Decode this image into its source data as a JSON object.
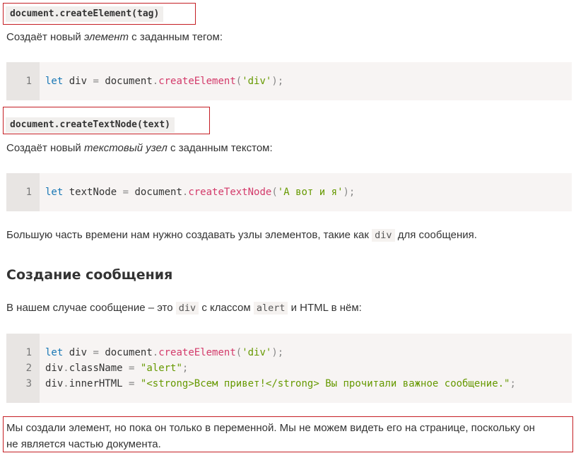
{
  "sections": [
    {
      "method_chip": "document.createElement(tag)",
      "desc_before": "Создаёт новый ",
      "desc_em": "элемент",
      "desc_after": " с заданным тегом:",
      "code": {
        "line_numbers": [
          "1"
        ],
        "lines": [
          [
            {
              "t": "let",
              "c": "kw"
            },
            {
              "t": " div ",
              "c": ""
            },
            {
              "t": "=",
              "c": "op"
            },
            {
              "t": " document",
              "c": ""
            },
            {
              "t": ".",
              "c": "op"
            },
            {
              "t": "createElement",
              "c": "fn"
            },
            {
              "t": "(",
              "c": "op"
            },
            {
              "t": "'div'",
              "c": "str"
            },
            {
              "t": ");",
              "c": "op"
            }
          ]
        ]
      }
    },
    {
      "method_chip": "document.createTextNode(text)",
      "desc_before": "Создаёт новый ",
      "desc_em": "текстовый узел",
      "desc_after": " с заданным текстом:",
      "code": {
        "line_numbers": [
          "1"
        ],
        "lines": [
          [
            {
              "t": "let",
              "c": "kw"
            },
            {
              "t": " textNode ",
              "c": ""
            },
            {
              "t": "=",
              "c": "op"
            },
            {
              "t": " document",
              "c": ""
            },
            {
              "t": ".",
              "c": "op"
            },
            {
              "t": "createTextNode",
              "c": "fn"
            },
            {
              "t": "(",
              "c": "op"
            },
            {
              "t": "'А вот и я'",
              "c": "str"
            },
            {
              "t": ");",
              "c": "op"
            }
          ]
        ]
      }
    }
  ],
  "para_most": {
    "before": "Большую часть времени нам нужно создавать узлы элементов, такие как ",
    "code": "div",
    "after": " для сообщения."
  },
  "heading": "Создание сообщения",
  "para_case": {
    "before": "В нашем случае сообщение – это ",
    "code1": "div",
    "middle": " с классом ",
    "code2": "alert",
    "after": " и HTML в нём:"
  },
  "code3": {
    "line_numbers": [
      "1",
      "2",
      "3"
    ],
    "lines": [
      [
        {
          "t": "let",
          "c": "kw"
        },
        {
          "t": " div ",
          "c": ""
        },
        {
          "t": "=",
          "c": "op"
        },
        {
          "t": " document",
          "c": ""
        },
        {
          "t": ".",
          "c": "op"
        },
        {
          "t": "createElement",
          "c": "fn"
        },
        {
          "t": "(",
          "c": "op"
        },
        {
          "t": "'div'",
          "c": "str"
        },
        {
          "t": ");",
          "c": "op"
        }
      ],
      [
        {
          "t": "div",
          "c": ""
        },
        {
          "t": ".",
          "c": "op"
        },
        {
          "t": "className ",
          "c": ""
        },
        {
          "t": "=",
          "c": "op"
        },
        {
          "t": " ",
          "c": ""
        },
        {
          "t": "\"alert\"",
          "c": "str"
        },
        {
          "t": ";",
          "c": "op"
        }
      ],
      [
        {
          "t": "div",
          "c": ""
        },
        {
          "t": ".",
          "c": "op"
        },
        {
          "t": "innerHTML ",
          "c": ""
        },
        {
          "t": "=",
          "c": "op"
        },
        {
          "t": " ",
          "c": ""
        },
        {
          "t": "\"<strong>Всем привет!</strong> Вы прочитали важное сообщение.\"",
          "c": "str"
        },
        {
          "t": ";",
          "c": "op"
        }
      ]
    ]
  },
  "final_note": {
    "line1": "Мы создали элемент, но пока он только в переменной. Мы не можем видеть его на странице, поскольку он",
    "line2": "не является частью документа."
  },
  "colors": {
    "highlight_border": "#c41e24",
    "code_bg": "#f7f4f3",
    "gutter_bg": "#e8e5e3",
    "keyword": "#1877b5",
    "function": "#d33a6a",
    "string": "#669900"
  }
}
